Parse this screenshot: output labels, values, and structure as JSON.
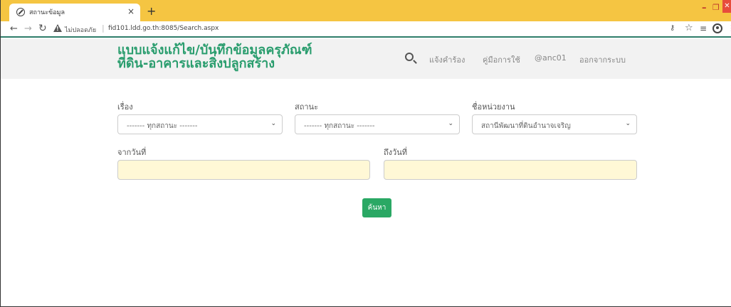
{
  "browser": {
    "tab_title": "สถานะข้อมูล",
    "tab_close": "×",
    "new_tab": "+",
    "not_secure": "ไม่ปลอดภัย",
    "url": "fid101.ldd.go.th:8085/Search.aspx",
    "icons": [
      "globe-icon",
      "close-icon",
      "plus-icon",
      "back-arrow-icon",
      "forward-arrow-icon",
      "reload-icon",
      "warning-icon",
      "key-icon",
      "star-icon",
      "reading-list-icon",
      "profile-icon",
      "more-menu-icon"
    ]
  },
  "site": {
    "brand_line1": "แบบแจ้งแก้ไข/บันทึกข้อมูลครุภัณฑ์",
    "brand_line2": "ที่ดิน-อาคารและสิ่งปลูกสร้าง",
    "brand_color": "#2a9d6e",
    "nav": {
      "report": "แจ้งคำร้อง",
      "manual": "คู่มือการใช้",
      "user": "@anc01",
      "logout": "ออกจากระบบ"
    }
  },
  "form": {
    "subject_label": "เรื่อง",
    "subject_value": "------- ทุกสถานะ -------",
    "status_label": "สถานะ",
    "status_value": "------- ทุกสถานะ -------",
    "unit_label": "ชื่อหน่วยงาน",
    "unit_value": "สถานีพัฒนาที่ดินอำนาจเจริญ",
    "from_date_label": "จากวันที่",
    "from_date_value": "",
    "to_date_label": "ถึงวันที่",
    "to_date_value": "",
    "search_button": "ค้นหา",
    "button_color": "#2aa864",
    "date_field_color": "#fff8d6"
  }
}
